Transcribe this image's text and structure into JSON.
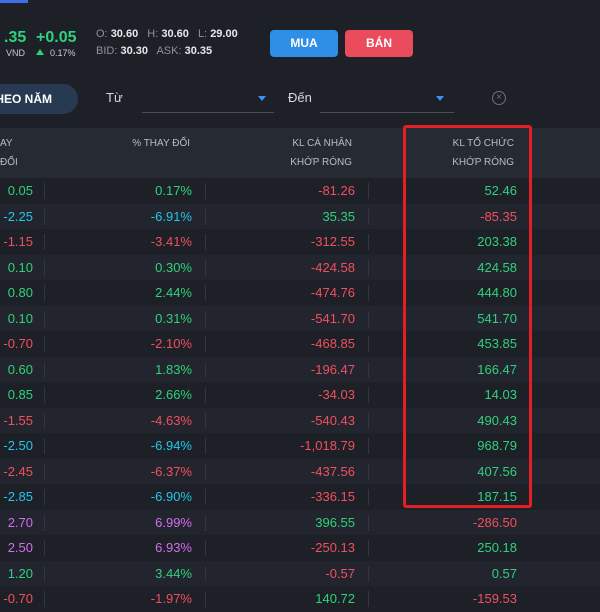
{
  "header": {
    "price": ".35",
    "change": "+0.05",
    "unit": "VND",
    "change_pct": "0.17%",
    "open_label": "O:",
    "open": "30.60",
    "high_label": "H:",
    "high": "30.60",
    "low_label": "L:",
    "low": "29.00",
    "bid_label": "BID:",
    "bid": "30.30",
    "ask_label": "ASK:",
    "ask": "30.35",
    "buy_label": "MUA",
    "sell_label": "BÁN"
  },
  "filters": {
    "period_label": "HEO NĂM",
    "from_label": "Từ",
    "to_label": "Đến"
  },
  "table": {
    "headers": {
      "change": "AY ĐỔI",
      "pct_change": "% THAY ĐỔI",
      "individual_line1": "KL CÁ NHÂN",
      "individual_line2": "KHỚP RÒNG",
      "institution_line1": "KL TỔ CHỨC",
      "institution_line2": "KHỚP RÒNG"
    },
    "rows": [
      {
        "change": "0.05",
        "pct": "0.17%",
        "individual": "-81.26",
        "institution": "52.46"
      },
      {
        "change": "-2.25",
        "pct": "-6.91%",
        "individual": "35.35",
        "institution": "-85.35"
      },
      {
        "change": "-1.15",
        "pct": "-3.41%",
        "individual": "-312.55",
        "institution": "203.38"
      },
      {
        "change": "0.10",
        "pct": "0.30%",
        "individual": "-424.58",
        "institution": "424.58"
      },
      {
        "change": "0.80",
        "pct": "2.44%",
        "individual": "-474.76",
        "institution": "444.80"
      },
      {
        "change": "0.10",
        "pct": "0.31%",
        "individual": "-541.70",
        "institution": "541.70"
      },
      {
        "change": "-0.70",
        "pct": "-2.10%",
        "individual": "-468.85",
        "institution": "453.85"
      },
      {
        "change": "0.60",
        "pct": "1.83%",
        "individual": "-196.47",
        "institution": "166.47"
      },
      {
        "change": "0.85",
        "pct": "2.66%",
        "individual": "-34.03",
        "institution": "14.03"
      },
      {
        "change": "-1.55",
        "pct": "-4.63%",
        "individual": "-540.43",
        "institution": "490.43"
      },
      {
        "change": "-2.50",
        "pct": "-6.94%",
        "individual": "-1,018.79",
        "institution": "968.79"
      },
      {
        "change": "-2.45",
        "pct": "-6.37%",
        "individual": "-437.56",
        "institution": "407.56"
      },
      {
        "change": "-2.85",
        "pct": "-6.90%",
        "individual": "-336.15",
        "institution": "187.15"
      },
      {
        "change": "2.70",
        "pct": "6.99%",
        "individual": "396.55",
        "institution": "-286.50"
      },
      {
        "change": "2.50",
        "pct": "6.93%",
        "individual": "-250.13",
        "institution": "250.18"
      },
      {
        "change": "1.20",
        "pct": "3.44%",
        "individual": "-0.57",
        "institution": "0.57"
      },
      {
        "change": "-0.70",
        "pct": "-1.97%",
        "individual": "140.72",
        "institution": "-159.53"
      }
    ]
  },
  "colors": {
    "up": "#2fd27c",
    "down": "#f0505e",
    "floor": "#21c8e8",
    "ceiling": "#d36ef0",
    "highlight": "#e51d24"
  }
}
